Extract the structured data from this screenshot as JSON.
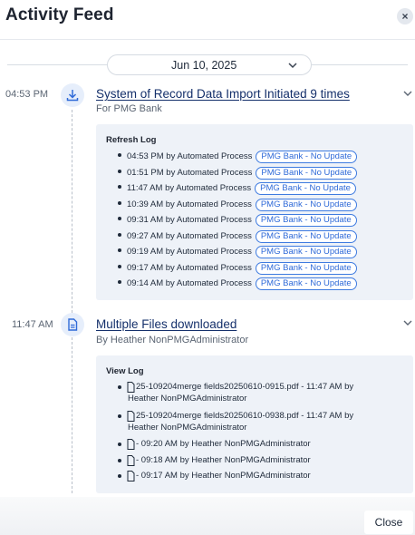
{
  "header": {
    "title": "Activity Feed",
    "close_symbol": "×"
  },
  "date_selector": {
    "value": "Jun 10, 2025"
  },
  "events": [
    {
      "time": "04:53 PM",
      "icon": "download-icon",
      "title": "System of Record Data Import Initiated 9 times",
      "subtitle": "For PMG Bank",
      "log_title": "Refresh Log",
      "entries": [
        {
          "text": "04:53 PM by Automated Process",
          "tag": "PMG Bank - No Update"
        },
        {
          "text": "01:51 PM by Automated Process",
          "tag": "PMG Bank - No Update"
        },
        {
          "text": "11:47 AM by Automated Process",
          "tag": "PMG Bank - No Update"
        },
        {
          "text": "10:39 AM by Automated Process",
          "tag": "PMG Bank - No Update"
        },
        {
          "text": "09:31 AM by Automated Process",
          "tag": "PMG Bank - No Update"
        },
        {
          "text": "09:27 AM by Automated Process",
          "tag": "PMG Bank - No Update"
        },
        {
          "text": "09:19 AM by Automated Process",
          "tag": "PMG Bank - No Update"
        },
        {
          "text": "09:17 AM by Automated Process",
          "tag": "PMG Bank - No Update"
        },
        {
          "text": "09:14 AM by Automated Process",
          "tag": "PMG Bank - No Update"
        }
      ]
    },
    {
      "time": "11:47 AM",
      "icon": "document-icon",
      "title": "Multiple Files downloaded",
      "subtitle": "By Heather NonPMGAdministrator",
      "log_title": "View Log",
      "files": [
        {
          "line1": "25-109204merge fields20250610-0915.pdf - 11:47 AM by",
          "line2": "Heather NonPMGAdministrator"
        },
        {
          "line1": "25-109204merge fields20250610-0938.pdf - 11:47 AM by",
          "line2": "Heather NonPMGAdministrator"
        },
        {
          "line1": "- 09:20 AM by Heather NonPMGAdministrator",
          "line2": ""
        },
        {
          "line1": "- 09:18 AM by Heather NonPMGAdministrator",
          "line2": ""
        },
        {
          "line1": "- 09:17 AM by Heather NonPMGAdministrator",
          "line2": ""
        }
      ]
    }
  ],
  "footer": {
    "close_label": "Close"
  },
  "colors": {
    "link": "#15306b",
    "tag_border": "#3e7be0",
    "log_bg": "#eef2f8",
    "icon_bg": "#e6eefb"
  }
}
